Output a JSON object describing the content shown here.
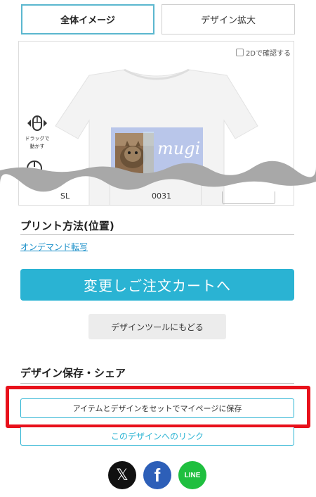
{
  "tabs": [
    {
      "label": "全体イメージ",
      "active": true
    },
    {
      "label": "デザイン拡大",
      "active": false
    }
  ],
  "preview": {
    "check_2d_label": "2Dで確認する",
    "drag_label_line1": "ドラッグで",
    "drag_label_line2": "動かす",
    "design_text": "mugi",
    "fragments": [
      "SL",
      "0031"
    ]
  },
  "print_section": {
    "title": "プリント方法(位置)",
    "link": "オンデマンド転写"
  },
  "cta_label": "変更しご注文カートへ",
  "back_label": "デザインツールにもどる",
  "share_section": {
    "title": "デザイン保存・シェア",
    "save_label": "アイテムとデザインをセットでマイページに保存",
    "link_label": "このデザインへのリンク"
  },
  "social": {
    "x_glyph": "𝕏",
    "facebook_glyph": "f",
    "line_label": "LINE"
  },
  "colors": {
    "accent": "#2ab3d3",
    "highlight": "#e8111b",
    "design_bg": "#b9c6ea"
  }
}
